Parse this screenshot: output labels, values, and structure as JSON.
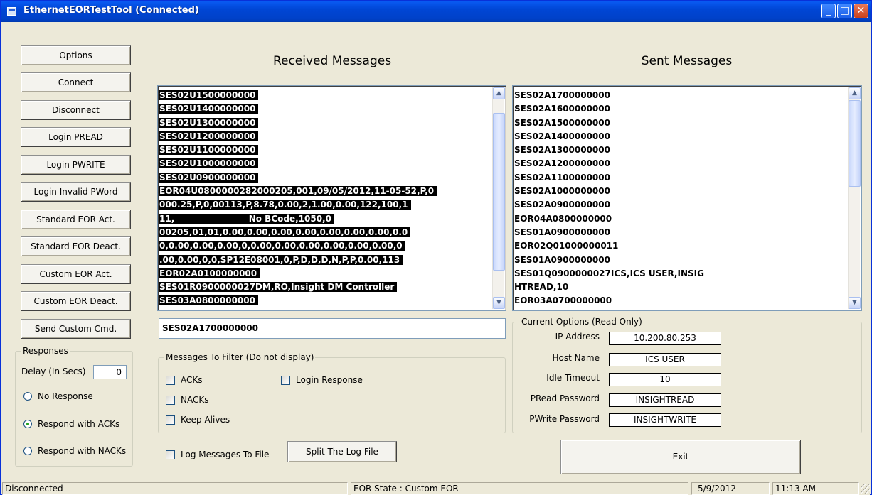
{
  "window": {
    "title": "EthernetEORTestTool (Connected)"
  },
  "left_buttons": [
    "Options",
    "Connect",
    "Disconnect",
    "Login PREAD",
    "Login PWRITE",
    "Login Invalid PWord",
    "Standard EOR Act.",
    "Standard EOR Deact.",
    "Custom EOR Act.",
    "Custom EOR Deact.",
    "Send Custom Cmd."
  ],
  "responses": {
    "legend": "Responses",
    "delay_label": "Delay (In Secs)",
    "delay_value": "0",
    "options": [
      {
        "label": "No Response",
        "selected": false
      },
      {
        "label": "Respond with ACKs",
        "selected": true
      },
      {
        "label": "Respond with NACKs",
        "selected": false
      }
    ]
  },
  "received": {
    "header": "Received Messages",
    "lines": [
      "SES02U1500000000",
      "SES02U1400000000",
      "SES02U1300000000",
      "SES02U1200000000",
      "SES02U1100000000",
      "SES02U1000000000",
      "SES02U0900000000",
      "EOR04U0800000282000205,001,09/05/2012,11-05-52,P,0",
      "000.25,P,0,00113,P,8.78,0.00,2,1.00,0.00,122,100,1",
      "11,                         No BCode,1050,0",
      "00205,01,01,0.00,0.00,0.00,0.00,0.00,0.00,0.00,0.0",
      "0,0.00,0.00,0.00,0,0.00,0.00,0.00,0.00,0.00,0.00,0",
      ".00,0.00,0,0,SP12E08001,0,P,D,D,D,N,P,P,0.00,113",
      "EOR02A0100000000",
      "SES01R0900000027DM,RO,Insight DM Controller",
      "SES03A0800000000"
    ]
  },
  "sent": {
    "header": "Sent Messages",
    "lines": [
      "SES02A1700000000",
      "SES02A1600000000",
      "SES02A1500000000",
      "SES02A1400000000",
      "SES02A1300000000",
      "SES02A1200000000",
      "SES02A1100000000",
      "SES02A1000000000",
      "SES02A0900000000",
      "EOR04A0800000000",
      "SES01A0900000000",
      "EOR02Q01000000011",
      "SES01A0900000000",
      "SES01Q0900000027ICS,ICS USER,INSIG",
      "HTREAD,10",
      "EOR03A0700000000"
    ]
  },
  "selected_message": "SES02A1700000000",
  "filter": {
    "legend": "Messages To Filter (Do not display)",
    "items": [
      {
        "label": "ACKs",
        "checked": false
      },
      {
        "label": "Login Response",
        "checked": false
      },
      {
        "label": "NACKs",
        "checked": false
      },
      {
        "label": "Keep Alives",
        "checked": false
      }
    ]
  },
  "log": {
    "label": "Log Messages To File",
    "checked": false,
    "split_label": "Split The Log File"
  },
  "options_group": {
    "legend": "Current Options (Read Only)",
    "fields": [
      {
        "label": "IP Address",
        "value": "10.200.80.253"
      },
      {
        "label": "Host Name",
        "value": "ICS USER"
      },
      {
        "label": "Idle Timeout",
        "value": "10"
      },
      {
        "label": "PRead Password",
        "value": "INSIGHTREAD"
      },
      {
        "label": "PWrite Password",
        "value": "INSIGHTWRITE"
      }
    ]
  },
  "exit_label": "Exit",
  "status": {
    "connection": "Disconnected",
    "eor_state": "EOR State : Custom EOR",
    "date": "5/9/2012",
    "time": "11:13 AM"
  },
  "colors": {
    "title_bar": "#0054e3",
    "face": "#ece9d8",
    "selection": "#000000"
  }
}
